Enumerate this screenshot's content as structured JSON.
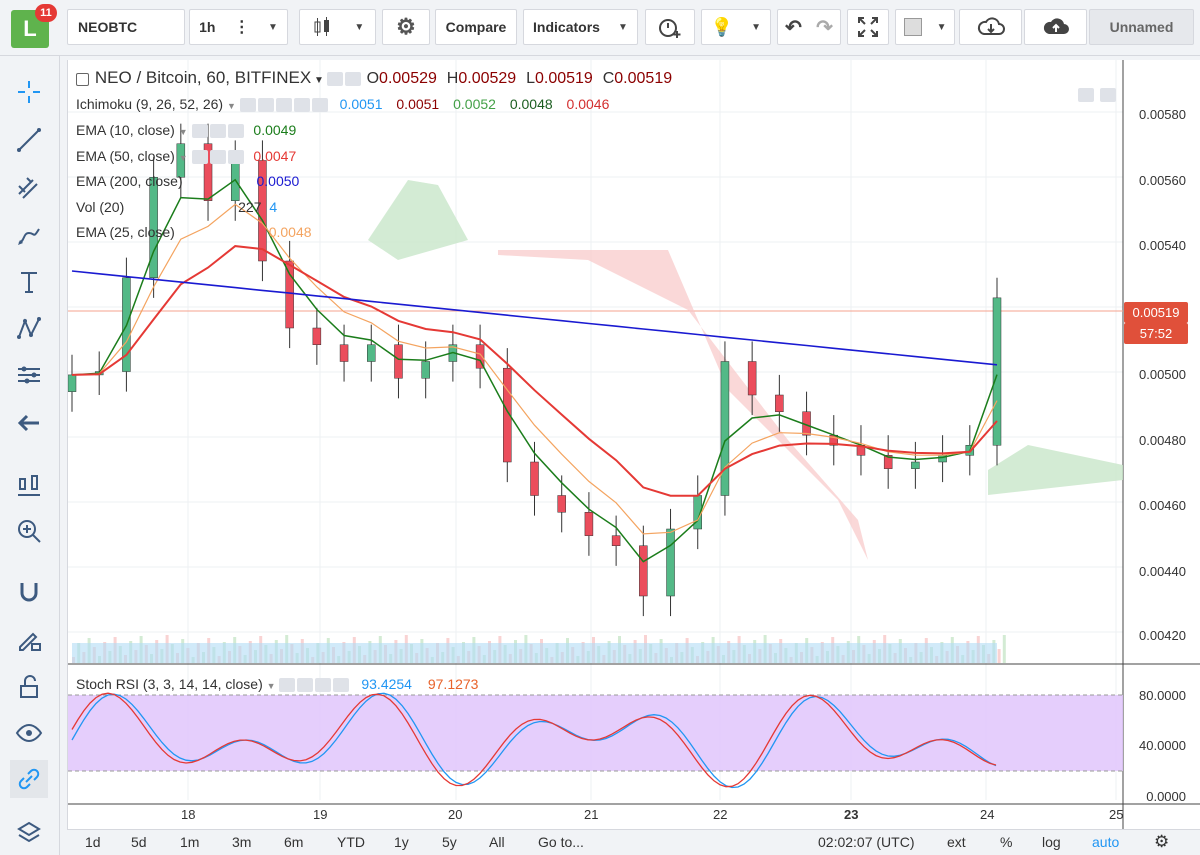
{
  "app": {
    "badge": "11",
    "logo_letter": "L"
  },
  "toolbar": {
    "symbol": "NEOBTC",
    "interval": "1h",
    "compare": "Compare",
    "indicators": "Indicators",
    "layout_name": "Unnamed"
  },
  "legend": {
    "title": "NEO / Bitcoin, 60, BITFINEX",
    "o_label": "O",
    "o": "0.00529",
    "h_label": "H",
    "h": "0.00529",
    "l_label": "L",
    "l": "0.00519",
    "c_label": "C",
    "c": "0.00519"
  },
  "indicators": [
    {
      "name": "Ichimoku (9, 26, 52, 26)",
      "values": [
        "0.0051",
        "0.0051",
        "0.0052",
        "0.0048",
        "0.0046"
      ],
      "colors": [
        "#2196f3",
        "#8b0000",
        "#43a047",
        "#1b5e20",
        "#d32f2f"
      ]
    },
    {
      "name": "EMA (10, close)",
      "values": [
        "0.0049"
      ],
      "colors": [
        "#1b7d1b"
      ]
    },
    {
      "name": "EMA (50, close)",
      "values": [
        "0.0047"
      ],
      "colors": [
        "#e53935"
      ]
    },
    {
      "name": "EMA (200, close)",
      "values": [
        "0.0050"
      ],
      "colors": [
        "#1a1ad1"
      ]
    },
    {
      "name": "Vol (20)",
      "values": [
        "227",
        "4"
      ],
      "colors": [
        "#333",
        "#2196f3"
      ]
    },
    {
      "name": "EMA (25, close)",
      "values": [
        "0.0048"
      ],
      "colors": [
        "#f4a460"
      ]
    }
  ],
  "price_axis": [
    "0.00580",
    "0.00560",
    "0.00540",
    "0.00520",
    "0.00500",
    "0.00480",
    "0.00460",
    "0.00440",
    "0.00420"
  ],
  "price_tag": {
    "price": "0.00519",
    "countdown": "57:52"
  },
  "stoch": {
    "name": "Stoch RSI (3, 3, 14, 14, close)",
    "k": "93.4254",
    "d": "97.1273",
    "axis": [
      "80.0000",
      "40.0000",
      "0.0000"
    ]
  },
  "time_axis": [
    "18",
    "19",
    "20",
    "21",
    "22",
    "23",
    "24",
    "25"
  ],
  "bottom": {
    "ranges": [
      "1d",
      "5d",
      "1m",
      "3m",
      "6m",
      "YTD",
      "1y",
      "5y",
      "All"
    ],
    "goto": "Go to...",
    "clock": "02:02:07 (UTC)",
    "ext": "ext",
    "pct": "%",
    "log": "log",
    "auto": "auto"
  },
  "colors": {
    "up": "#53b987",
    "down": "#eb4d5c",
    "ema200": "#1a1ad1",
    "ema50": "#e53935",
    "ema10": "#1b7d1b",
    "ema25": "#f4a460",
    "cloud_up": "#c8e6c9",
    "cloud_down": "#f8c8c8",
    "stoch_band": "#e1c6fb",
    "stoch_k": "#2196f3",
    "stoch_d": "#e53935"
  },
  "chart_data": {
    "type": "candlestick",
    "title": "NEO / Bitcoin, 60, BITFINEX",
    "ylim": [
      0.0041,
      0.0059
    ],
    "x_ticks": [
      "18",
      "19",
      "20",
      "21",
      "22",
      "23",
      "24",
      "25"
    ],
    "close_approx": [
      0.00496,
      0.00497,
      0.00525,
      0.00555,
      0.00565,
      0.00548,
      0.0056,
      0.0053,
      0.0051,
      0.00505,
      0.005,
      0.00505,
      0.00495,
      0.005,
      0.00505,
      0.00498,
      0.0047,
      0.0046,
      0.00455,
      0.00448,
      0.00445,
      0.0043,
      0.0045,
      0.0046,
      0.005,
      0.0049,
      0.00485,
      0.00478,
      0.00475,
      0.00472,
      0.00468,
      0.0047,
      0.00472,
      0.00475,
      0.00519
    ]
  }
}
